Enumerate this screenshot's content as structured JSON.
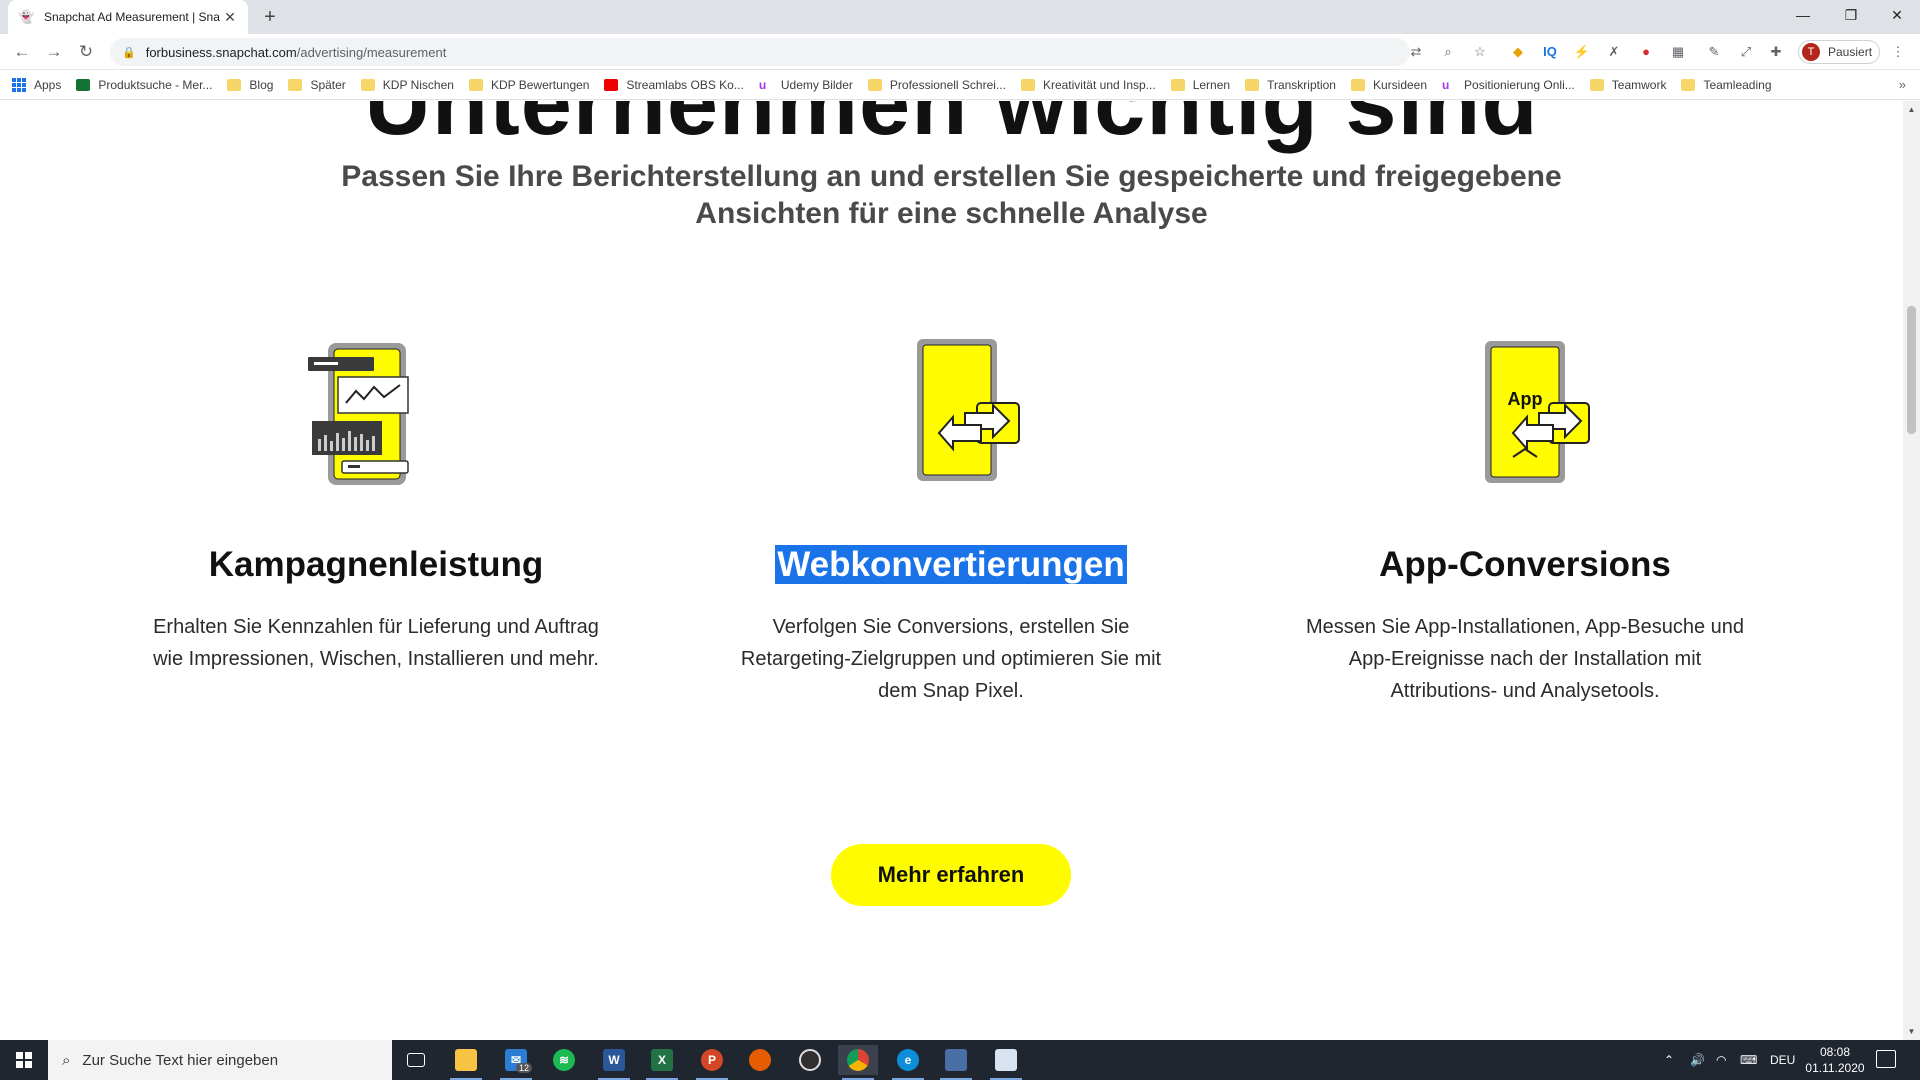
{
  "browser": {
    "tab_title": "Snapchat Ad Measurement | Sna",
    "url_domain": "forbusiness.snapchat.com",
    "url_path": "/advertising/measurement",
    "profile_initial": "T",
    "profile_status": "Pausiert"
  },
  "bookmarks": [
    {
      "label": "Apps",
      "icon": "apps-grid-icon"
    },
    {
      "label": "Produktsuche - Mer...",
      "icon": "merchant-icon"
    },
    {
      "label": "Blog",
      "icon": "folder-icon"
    },
    {
      "label": "Später",
      "icon": "folder-icon"
    },
    {
      "label": "KDP Nischen",
      "icon": "folder-icon"
    },
    {
      "label": "KDP Bewertungen",
      "icon": "folder-icon"
    },
    {
      "label": "Streamlabs OBS Ko...",
      "icon": "youtube-icon"
    },
    {
      "label": "Udemy Bilder",
      "icon": "udemy-icon"
    },
    {
      "label": "Professionell Schrei...",
      "icon": "folder-icon"
    },
    {
      "label": "Kreativität und Insp...",
      "icon": "folder-icon"
    },
    {
      "label": "Lernen",
      "icon": "folder-icon"
    },
    {
      "label": "Transkription",
      "icon": "folder-icon"
    },
    {
      "label": "Kursideen",
      "icon": "folder-icon"
    },
    {
      "label": "Positionierung Onli...",
      "icon": "udemy-icon"
    },
    {
      "label": "Teamwork",
      "icon": "folder-icon"
    },
    {
      "label": "Teamleading",
      "icon": "folder-icon"
    }
  ],
  "page": {
    "heading_partial": "Unternehmen wichtig sind",
    "subheading": "Passen Sie Ihre Berichterstellung an und erstellen Sie gespeicherte und freigegebene Ansichten für eine schnelle Analyse",
    "features": [
      {
        "title": "Kampagnenleistung",
        "text": "Erhalten Sie Kennzahlen für Lieferung und Auftrag wie Impressionen, Wischen, Installieren und mehr.",
        "icon": "campaign-performance-phone-icon"
      },
      {
        "title": "Webkonvertierungen",
        "text": "Verfolgen Sie Conversions, erstellen Sie Retargeting-Zielgruppen und optimieren Sie mit dem Snap Pixel.",
        "icon": "web-conversion-phone-icon",
        "selected": true
      },
      {
        "title": "App-Conversions",
        "text": "Messen Sie App-Installationen, App-Besuche und App-Ereignisse nach der Installation mit Attributions- und Analysetools.",
        "icon": "app-conversion-phone-icon",
        "icon_label": "App"
      }
    ],
    "cta_label": "Mehr erfahren",
    "accent_color": "#fffc00"
  },
  "taskbar": {
    "search_placeholder": "Zur Suche Text hier eingeben",
    "mail_badge": "12",
    "language": "DEU",
    "time": "08:08",
    "date": "01.11.2020"
  }
}
